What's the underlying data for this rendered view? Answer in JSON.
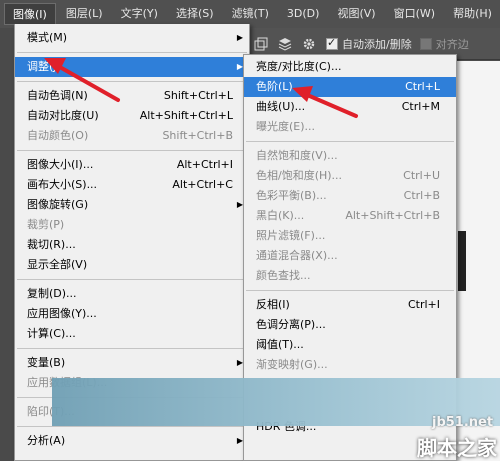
{
  "menubar": {
    "items": [
      "图像(I)",
      "图层(L)",
      "文字(Y)",
      "选择(S)",
      "滤镜(T)",
      "3D(D)",
      "视图(V)",
      "窗口(W)",
      "帮助(H)"
    ]
  },
  "options_bar": {
    "auto_add_label": "自动添加/删除",
    "align_label": "对齐边"
  },
  "image_menu": {
    "items": [
      {
        "label": "模式(M)",
        "shortcut": "",
        "submenu": true
      },
      {
        "label": "调整(J)",
        "shortcut": "",
        "submenu": true,
        "highlight": true
      },
      {
        "label": "自动色调(N)",
        "shortcut": "Shift+Ctrl+L"
      },
      {
        "label": "自动对比度(U)",
        "shortcut": "Alt+Shift+Ctrl+L"
      },
      {
        "label": "自动颜色(O)",
        "shortcut": "Shift+Ctrl+B",
        "dim": true
      },
      {
        "label": "图像大小(I)...",
        "shortcut": "Alt+Ctrl+I"
      },
      {
        "label": "画布大小(S)...",
        "shortcut": "Alt+Ctrl+C"
      },
      {
        "label": "图像旋转(G)",
        "shortcut": "",
        "submenu": true
      },
      {
        "label": "裁剪(P)",
        "shortcut": "",
        "dim": true
      },
      {
        "label": "裁切(R)...",
        "shortcut": ""
      },
      {
        "label": "显示全部(V)",
        "shortcut": ""
      },
      {
        "label": "复制(D)...",
        "shortcut": ""
      },
      {
        "label": "应用图像(Y)...",
        "shortcut": ""
      },
      {
        "label": "计算(C)...",
        "shortcut": ""
      },
      {
        "label": "变量(B)",
        "shortcut": "",
        "submenu": true
      },
      {
        "label": "应用数据组(L)...",
        "shortcut": "",
        "dim": true
      },
      {
        "label": "陷印(T)...",
        "shortcut": "",
        "dim": true
      },
      {
        "label": "分析(A)",
        "shortcut": "",
        "submenu": true
      }
    ]
  },
  "adjust_submenu": {
    "items": [
      {
        "label": "亮度/对比度(C)...",
        "shortcut": ""
      },
      {
        "label": "色阶(L)...",
        "shortcut": "Ctrl+L",
        "highlight": true
      },
      {
        "label": "曲线(U)...",
        "shortcut": "Ctrl+M"
      },
      {
        "label": "曝光度(E)...",
        "shortcut": "",
        "dim": true
      },
      {
        "label": "自然饱和度(V)...",
        "shortcut": "",
        "dim": true
      },
      {
        "label": "色相/饱和度(H)...",
        "shortcut": "Ctrl+U",
        "dim": true
      },
      {
        "label": "色彩平衡(B)...",
        "shortcut": "Ctrl+B",
        "dim": true
      },
      {
        "label": "黑白(K)...",
        "shortcut": "Alt+Shift+Ctrl+B",
        "dim": true
      },
      {
        "label": "照片滤镜(F)...",
        "shortcut": "",
        "dim": true
      },
      {
        "label": "通道混合器(X)...",
        "shortcut": "",
        "dim": true
      },
      {
        "label": "颜色查找...",
        "shortcut": "",
        "dim": true
      },
      {
        "label": "反相(I)",
        "shortcut": "Ctrl+I"
      },
      {
        "label": "色调分离(P)...",
        "shortcut": ""
      },
      {
        "label": "阈值(T)...",
        "shortcut": ""
      },
      {
        "label": "渐变映射(G)...",
        "shortcut": "",
        "dim": true
      },
      {
        "label": "HDR 色调...",
        "shortcut": ""
      }
    ]
  },
  "watermark": {
    "site": "jb51.net",
    "name": "脚本之家"
  },
  "colors": {
    "highlight": "#2f7fd9",
    "arrow": "#e0202a"
  }
}
